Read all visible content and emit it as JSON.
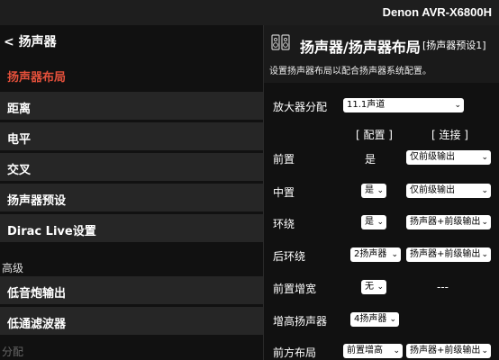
{
  "header": {
    "model": "Denon AVR-X6800H"
  },
  "left": {
    "back_label": "< 扬声器",
    "items": [
      {
        "label": "扬声器布局"
      },
      {
        "label": "距离"
      },
      {
        "label": "电平"
      },
      {
        "label": "交叉"
      },
      {
        "label": "扬声器预设"
      },
      {
        "label": "Dirac Live设置"
      }
    ],
    "advanced_label": "高级",
    "advanced_items": [
      {
        "label": "低音炮输出"
      },
      {
        "label": "低通滤波器"
      }
    ],
    "assign_label": "分配"
  },
  "right": {
    "title": "扬声器/扬声器布局",
    "preset": "[扬声器预设1]",
    "description": "设置扬声器布局以配合扬声器系统配置。",
    "amp_assign_label": "放大器分配",
    "amp_assign_value": "11.1声道",
    "col_config": "[ 配置 ]",
    "col_connect": "[ 连接 ]",
    "rows": [
      {
        "label": "前置",
        "config": "是",
        "connect": "仅前级输出"
      },
      {
        "label": "中置",
        "config": "是",
        "connect": "仅前级输出"
      },
      {
        "label": "环绕",
        "config": "是",
        "connect": "扬声器+前级输出"
      },
      {
        "label": "后环绕",
        "config": "2扬声器",
        "connect": "扬声器+前级输出"
      },
      {
        "label": "前置增宽",
        "config": "无",
        "connect": "---"
      },
      {
        "label": "增高扬声器",
        "config": "4扬声器",
        "connect": ""
      },
      {
        "label": "前方布局",
        "config": "前置增高",
        "connect": "扬声器+前级输出"
      }
    ]
  }
}
